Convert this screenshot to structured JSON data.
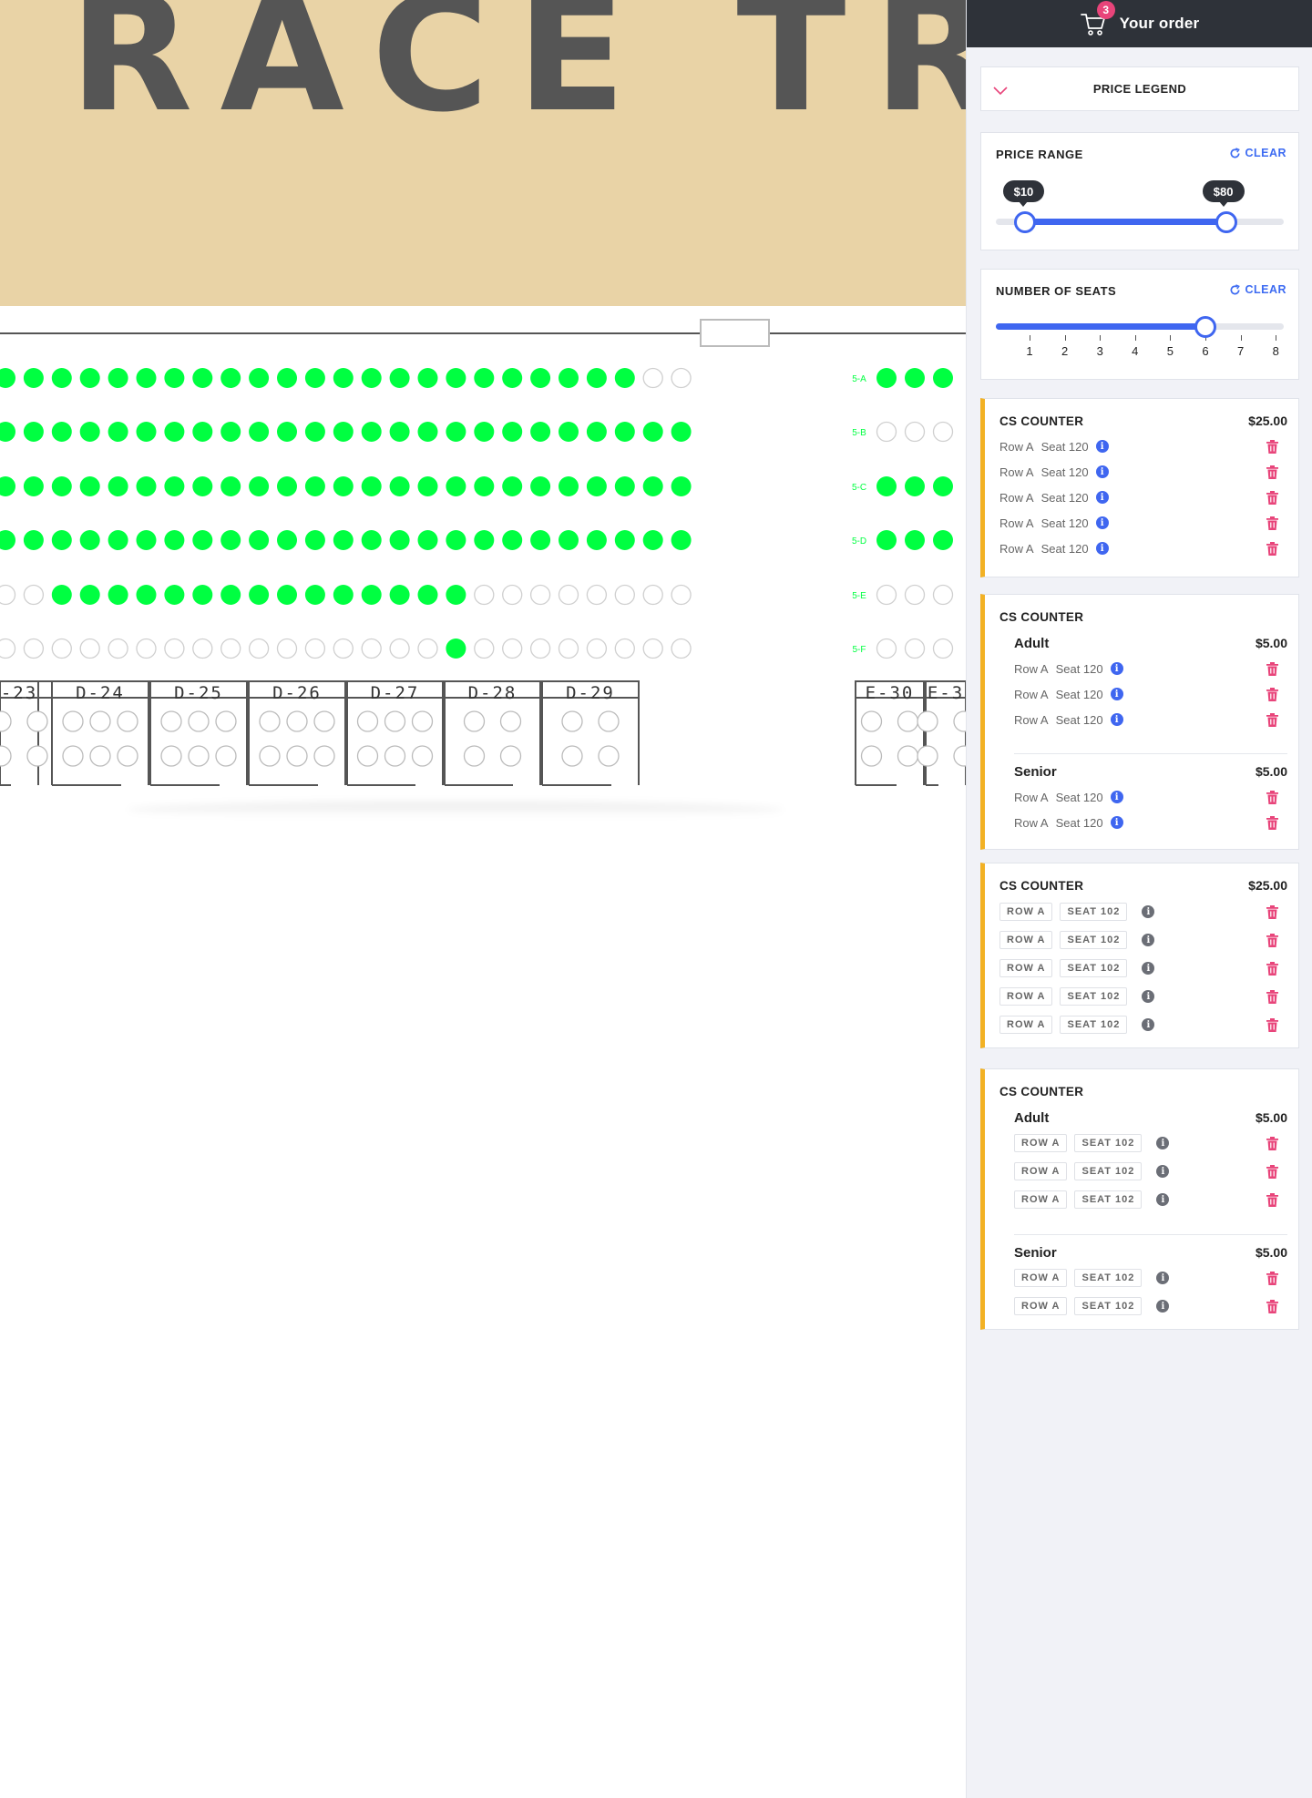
{
  "banner": {
    "text": "RACE TRA"
  },
  "row_labels": [
    "5-A",
    "5-B",
    "5-C",
    "5-D",
    "5-E",
    "5-F"
  ],
  "seat_rows": [
    {
      "left": "1111111111111111111111100",
      "right": "111"
    },
    {
      "left": "1111111111111111111111111",
      "right": "000"
    },
    {
      "left": "1111111111111111111111111",
      "right": "111"
    },
    {
      "left": "1111111111111111111111111",
      "right": "111"
    },
    {
      "left": "0011111111111111100000000",
      "right": "000"
    },
    {
      "left": "0000000000000000100000000",
      "right": "000"
    }
  ],
  "tables": [
    "-23",
    "D-24",
    "D-25",
    "D-26",
    "D-27",
    "D-28",
    "D-29",
    "E-30",
    "E-3"
  ],
  "colors": {
    "available": "#00ff41",
    "empty_border": "#cccccc",
    "accent": "#3f66f0",
    "order_stripe": "#f2b124",
    "trash": "#e8447a",
    "header": "#2e3239"
  },
  "order": {
    "title": "Your order",
    "count": "3"
  },
  "price_legend": {
    "label": "PRICE LEGEND"
  },
  "price_range": {
    "title": "PRICE RANGE",
    "clear": "CLEAR",
    "min_label": "$10",
    "max_label": "$80",
    "min_value": 10,
    "max_value": 80,
    "scale_min": 0,
    "scale_max": 100
  },
  "num_seats": {
    "title": "NUMBER OF SEATS",
    "clear": "CLEAR",
    "ticks": [
      "1",
      "2",
      "3",
      "4",
      "5",
      "6",
      "7",
      "8"
    ],
    "value": 6
  },
  "cards": [
    {
      "title": "CS COUNTER",
      "price": "$25.00",
      "style": "plain",
      "items": [
        {
          "row": "Row A",
          "seat": "Seat 120"
        },
        {
          "row": "Row A",
          "seat": "Seat 120"
        },
        {
          "row": "Row A",
          "seat": "Seat 120"
        },
        {
          "row": "Row A",
          "seat": "Seat 120"
        },
        {
          "row": "Row A",
          "seat": "Seat 120"
        }
      ]
    },
    {
      "title": "CS COUNTER",
      "style": "plain",
      "groups": [
        {
          "name": "Adult",
          "price": "$5.00",
          "items": [
            {
              "row": "Row A",
              "seat": "Seat 120"
            },
            {
              "row": "Row A",
              "seat": "Seat 120"
            },
            {
              "row": "Row A",
              "seat": "Seat 120"
            }
          ]
        },
        {
          "name": "Senior",
          "price": "$5.00",
          "items": [
            {
              "row": "Row A",
              "seat": "Seat 120"
            },
            {
              "row": "Row A",
              "seat": "Seat 120"
            }
          ]
        }
      ]
    },
    {
      "title": "CS COUNTER",
      "price": "$25.00",
      "style": "chip",
      "items": [
        {
          "row": "ROW A",
          "seat": "SEAT 102"
        },
        {
          "row": "ROW A",
          "seat": "SEAT 102"
        },
        {
          "row": "ROW A",
          "seat": "SEAT 102"
        },
        {
          "row": "ROW A",
          "seat": "SEAT 102"
        },
        {
          "row": "ROW A",
          "seat": "SEAT 102"
        }
      ]
    },
    {
      "title": "CS COUNTER",
      "style": "chip",
      "groups": [
        {
          "name": "Adult",
          "price": "$5.00",
          "items": [
            {
              "row": "ROW A",
              "seat": "SEAT 102"
            },
            {
              "row": "ROW A",
              "seat": "SEAT 102"
            },
            {
              "row": "ROW A",
              "seat": "SEAT 102"
            }
          ]
        },
        {
          "name": "Senior",
          "price": "$5.00",
          "items": [
            {
              "row": "ROW A",
              "seat": "SEAT 102"
            },
            {
              "row": "ROW A",
              "seat": "SEAT 102"
            }
          ]
        }
      ]
    }
  ]
}
